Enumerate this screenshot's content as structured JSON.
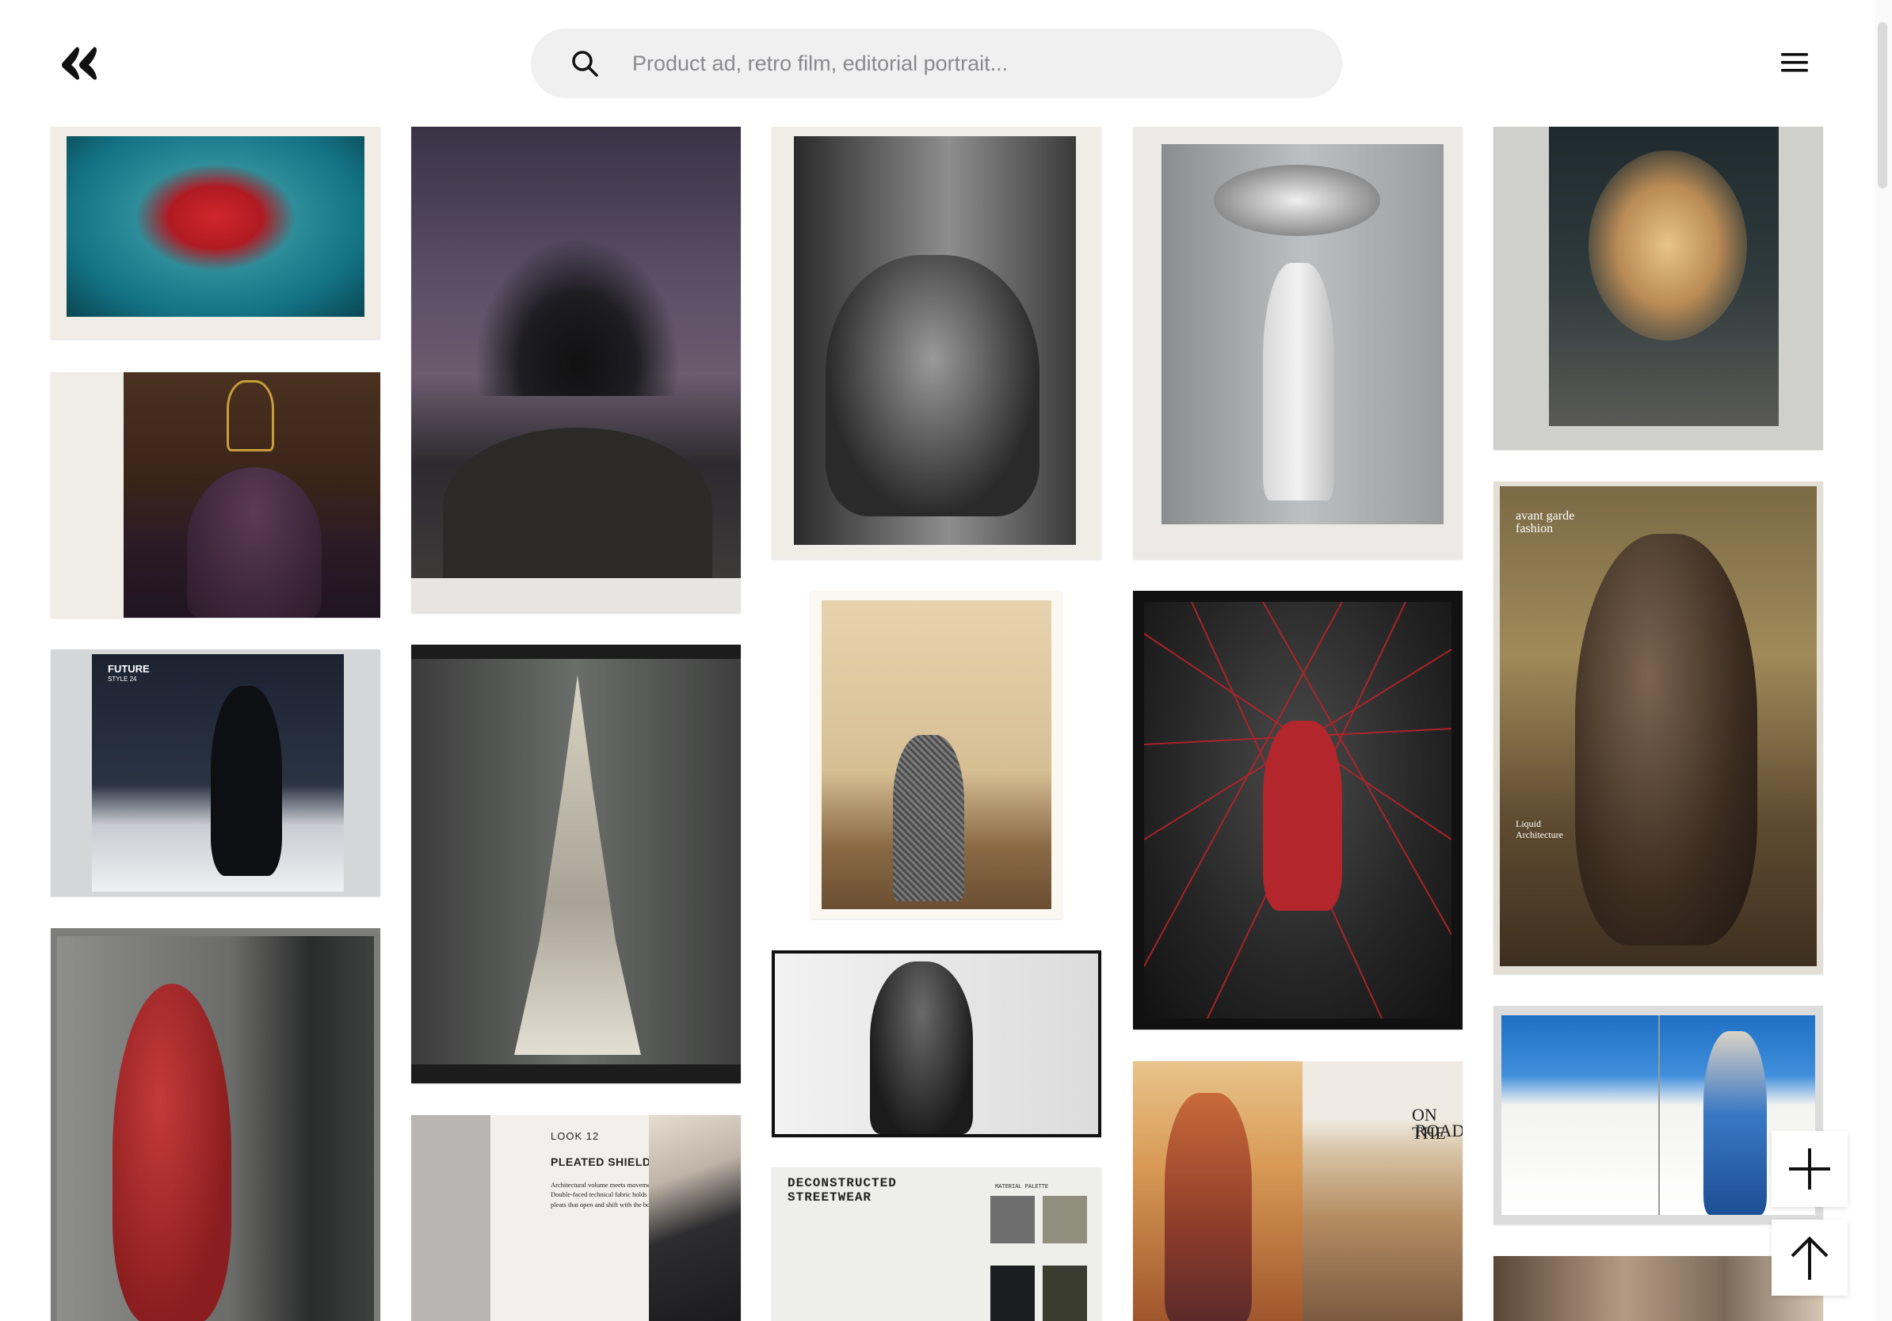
{
  "search": {
    "placeholder": "Product ad, retro film, editorial portrait..."
  },
  "icons": {
    "logo": "quote-logo-icon",
    "search": "search-icon",
    "menu": "hamburger-menu-icon",
    "add": "plus-icon",
    "top": "arrow-up-icon"
  },
  "colors": {
    "search_bg": "#f0f0f1",
    "placeholder": "#8a8a8d",
    "text": "#111111"
  },
  "cards": {
    "future": {
      "title": "FUTURE",
      "sub": "STYLE 24"
    },
    "avantgarde": {
      "title": "avant garde",
      "title2": "fashion",
      "caption": "Liquid",
      "caption2": "Architecture"
    },
    "look12": {
      "look": "LOOK 12",
      "title": "PLEATED SHIELD COAT",
      "body": "Architectural volume meets movement. Double-faced technical fabric holds precise pleats that open and shift with the body."
    },
    "deconstructed": {
      "title": "DECONSTRUCTED",
      "title2": "STREETWEAR",
      "label": "MATERIAL PALETTE"
    },
    "ontheroad": {
      "title": "ON THE",
      "title2": "ROAD"
    }
  }
}
